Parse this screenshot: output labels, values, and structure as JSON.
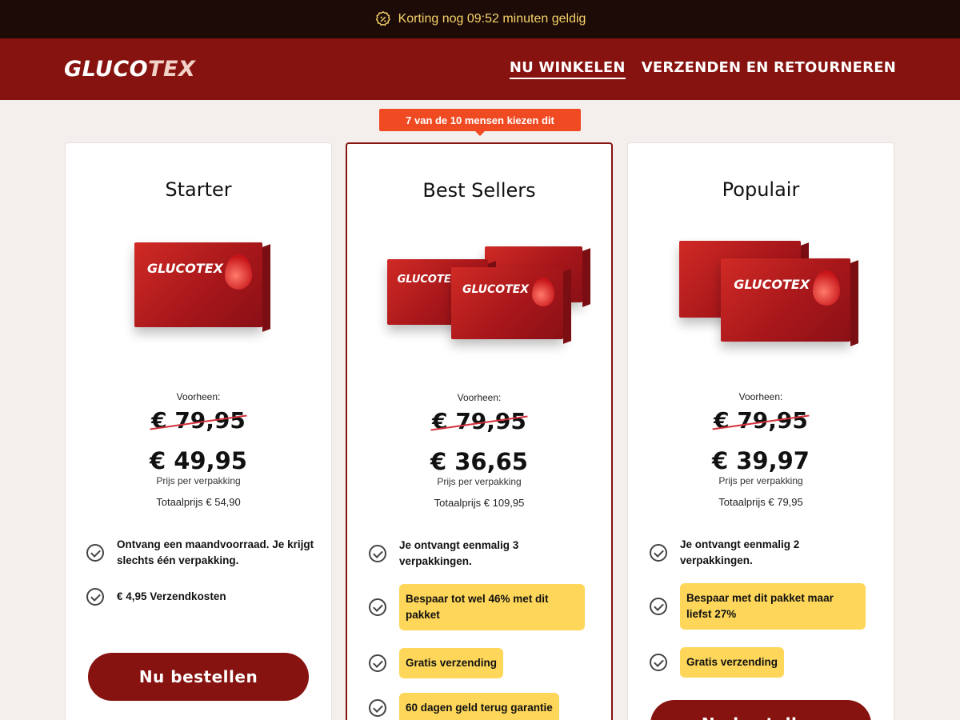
{
  "topbar": {
    "text": "Korting nog 09:52 minuten geldig",
    "icon": "discount-badge-icon",
    "color": "#f6d36a"
  },
  "header": {
    "logo_main": "GLUCO",
    "logo_accent": "TEX",
    "nav": [
      {
        "label": "NU WINKELEN",
        "active": true
      },
      {
        "label": "VERZENDEN EN RETOURNEREN",
        "active": false
      }
    ],
    "brand_color": "#86130f"
  },
  "ribbon": "7 van de 10 mensen kiezen dit",
  "cards": [
    {
      "title": "Starter",
      "prev_label": "Voorheen:",
      "old_price": "€ 79,95",
      "new_price": "€ 49,95",
      "per_pack": "Prijs per verpakking",
      "total": "Totaalprijs € 54,90",
      "features": [
        {
          "text": "Ontvang een maandvoorraad. Je krijgt slechts één verpakking.",
          "highlight": false
        },
        {
          "text": "€ 4,95 Verzendkosten",
          "highlight": false
        }
      ],
      "button": "Nu bestellen"
    },
    {
      "title": "Best Sellers",
      "prev_label": "Voorheen:",
      "old_price": "€ 79,95",
      "new_price": "€ 36,65",
      "per_pack": "Prijs per verpakking",
      "total": "Totaalprijs € 109,95",
      "features": [
        {
          "text": "Je ontvangt eenmalig 3 verpakkingen.",
          "highlight": false
        },
        {
          "text": "Bespaar tot wel 46% met dit pakket",
          "highlight": true
        },
        {
          "text": "Gratis verzending",
          "highlight": true
        },
        {
          "text": "60 dagen geld terug garantie",
          "highlight": true
        }
      ]
    },
    {
      "title": "Populair",
      "prev_label": "Voorheen:",
      "old_price": "€ 79,95",
      "new_price": "€ 39,97",
      "per_pack": "Prijs per verpakking",
      "total": "Totaalprijs € 79,95",
      "features": [
        {
          "text": "Je ontvangt eenmalig 2 verpakkingen.",
          "highlight": false
        },
        {
          "text": "Bespaar met dit pakket maar liefst 27%",
          "highlight": true
        },
        {
          "text": "Gratis verzending",
          "highlight": true
        }
      ],
      "button": "Nu bestellen"
    }
  ],
  "product": {
    "box_label": "GLUCOTEX"
  }
}
